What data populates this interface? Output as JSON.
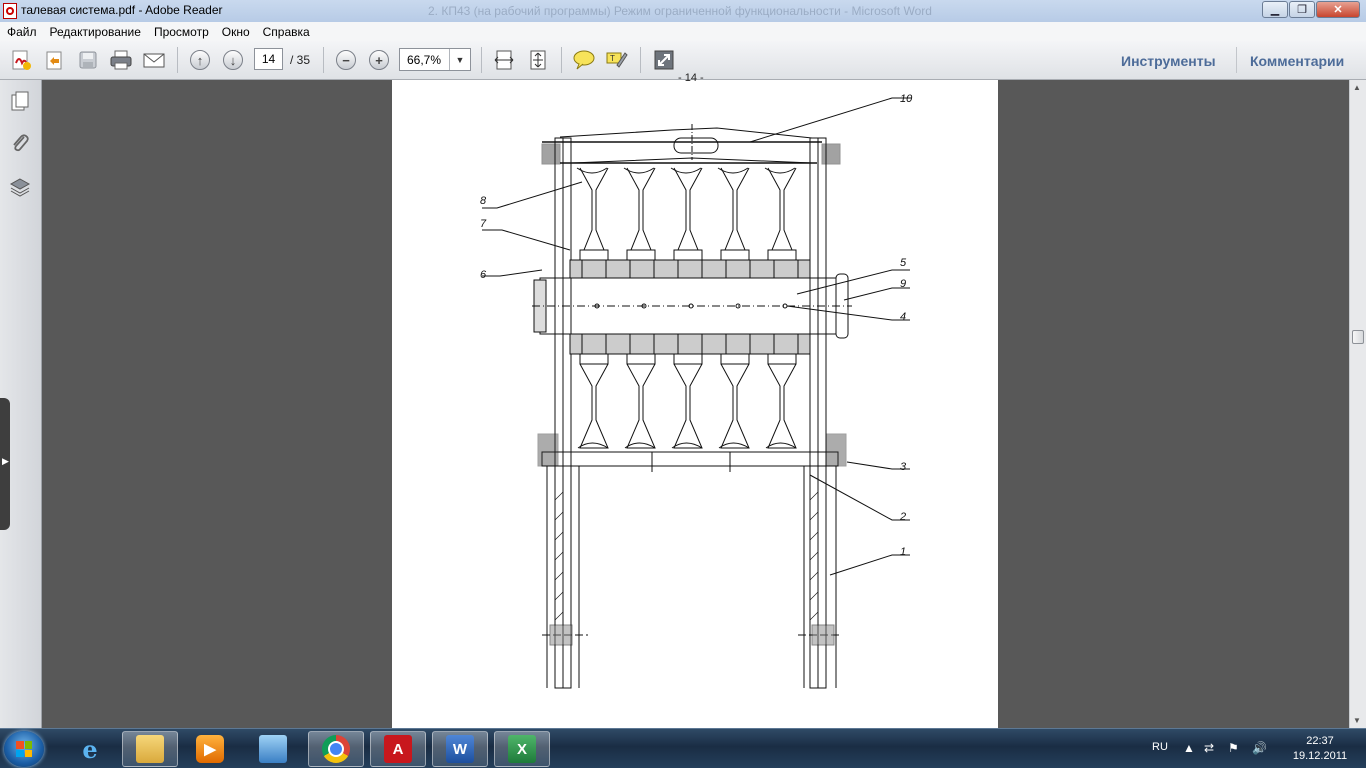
{
  "window": {
    "title": "талевая система.pdf - Adobe Reader",
    "background_title": "2. КП43 (на рабочий программы) Режим ограниченной функциональности - Microsoft Word"
  },
  "menu": [
    "Файл",
    "Редактирование",
    "Просмотр",
    "Окно",
    "Справка"
  ],
  "toolbar": {
    "page_current": "14",
    "page_total": "/ 35",
    "zoom": "66,7%",
    "tools_label": "Инструменты",
    "comments_label": "Комментарии",
    "icons": [
      "create-pdf-icon",
      "open-icon",
      "save-icon",
      "print-icon",
      "email-icon",
      "previous-page-icon",
      "next-page-icon",
      "zoom-out-icon",
      "zoom-in-icon",
      "fit-width-icon",
      "fit-page-icon",
      "comment-icon",
      "highlight-icon",
      "fullscreen-icon"
    ]
  },
  "document": {
    "page_number": "- 14 -",
    "callouts": [
      "10",
      "8",
      "7",
      "6",
      "5",
      "9",
      "4",
      "3",
      "2",
      "1"
    ]
  },
  "taskbar": {
    "apps": [
      "ie-icon",
      "explorer-icon",
      "media-player-icon",
      "photo-viewer-icon",
      "chrome-icon",
      "adobe-reader-icon",
      "word-icon",
      "excel-icon"
    ],
    "language": "RU",
    "time": "22:37",
    "date": "19.12.2011"
  },
  "colors": {
    "accent": "#4d6c99",
    "reader_red": "#c8171d"
  }
}
